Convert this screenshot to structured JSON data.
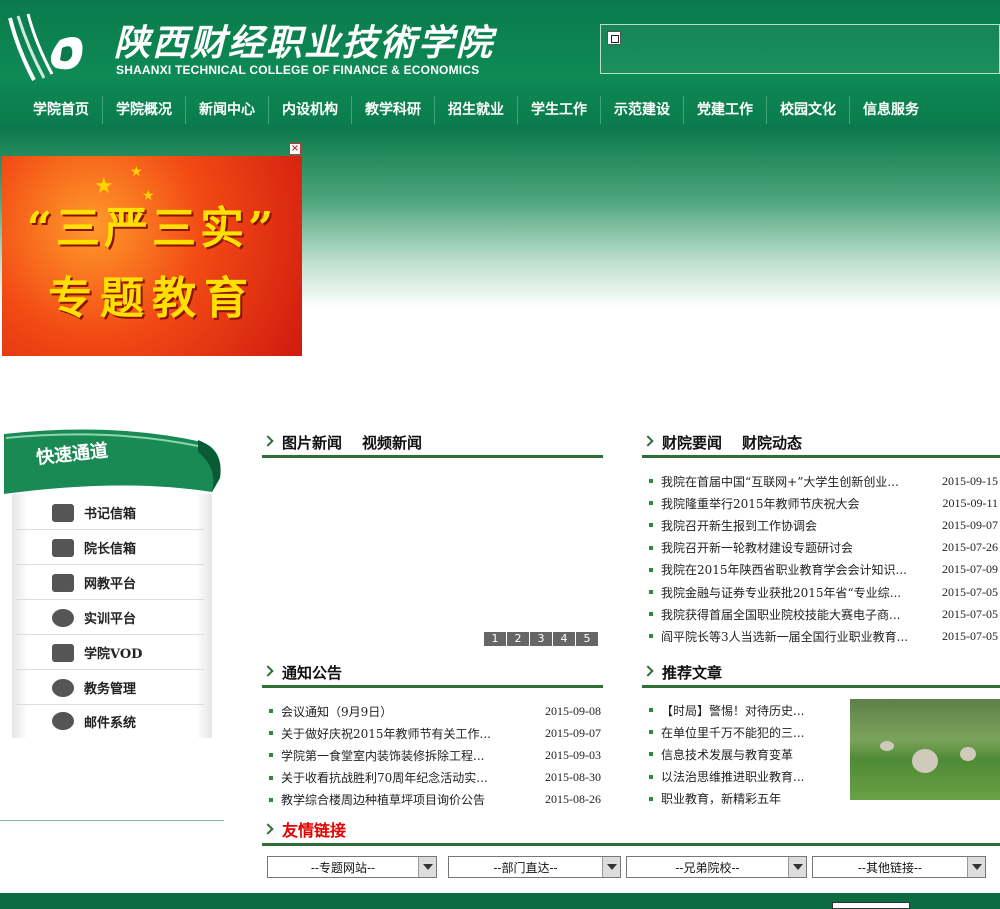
{
  "header": {
    "school_name_cn": "陕西财经职业技術学院",
    "school_name_en": "SHAANXI TECHNICAL COLLEGE OF FINANCE & ECONOMICS",
    "logo_icon": "college-logo-icon",
    "brand_color": "#0a7a4c"
  },
  "nav": {
    "items": [
      "学院首页",
      "学院概况",
      "新闻中心",
      "内设机构",
      "教学科研",
      "招生就业",
      "学生工作",
      "示范建设",
      "党建工作",
      "校园文化",
      "信息服务"
    ]
  },
  "banner": {
    "line1": "“三严三实”",
    "line2": "专题教育"
  },
  "quick": {
    "title": "快速通道",
    "items": [
      {
        "label": "书记信箱",
        "icon": "mailbox-icon"
      },
      {
        "label": "院长信箱",
        "icon": "envelope-icon"
      },
      {
        "label": "网教平台",
        "icon": "network-icon"
      },
      {
        "label": "实训平台",
        "icon": "refresh-icon"
      },
      {
        "label": "学院VOD",
        "icon": "monitor-icon"
      },
      {
        "label": "教务管理",
        "icon": "gear-icon"
      },
      {
        "label": "邮件系统",
        "icon": "mail-icon"
      }
    ]
  },
  "photo_news": {
    "tabs": [
      "图片新闻",
      "视频新闻"
    ],
    "pages": [
      "1",
      "2",
      "3",
      "4",
      "5"
    ]
  },
  "college_news": {
    "tabs": [
      "财院要闻",
      "财院动态"
    ],
    "items": [
      {
        "title": "我院在首届中国“互联网+”大学生创新创业...",
        "date": "2015-09-15"
      },
      {
        "title": "我院隆重举行2015年教师节庆祝大会",
        "date": "2015-09-11"
      },
      {
        "title": "我院召开新生报到工作协调会",
        "date": "2015-09-07"
      },
      {
        "title": "我院召开新一轮教材建设专题研讨会",
        "date": "2015-07-26"
      },
      {
        "title": "我院在2015年陕西省职业教育学会会计知识...",
        "date": "2015-07-09"
      },
      {
        "title": "我院金融与证券专业获批2015年省“专业综...",
        "date": "2015-07-05"
      },
      {
        "title": "我院获得首届全国职业院校技能大赛电子商...",
        "date": "2015-07-05"
      },
      {
        "title": "阎平院长等3人当选新一届全国行业职业教育...",
        "date": "2015-07-05"
      }
    ]
  },
  "notices": {
    "title": "通知公告",
    "items": [
      {
        "title": "会议通知（9月9日）",
        "date": "2015-09-08"
      },
      {
        "title": "关于做好庆祝2015年教师节有关工作...",
        "date": "2015-09-07"
      },
      {
        "title": "学院第一食堂室内装饰装修拆除工程...",
        "date": "2015-09-03"
      },
      {
        "title": "关于收看抗战胜利70周年纪念活动实...",
        "date": "2015-08-30"
      },
      {
        "title": "教学综合楼周边种植草坪项目询价公告",
        "date": "2015-08-26"
      }
    ]
  },
  "recommended": {
    "title": "推荐文章",
    "items": [
      "【时局】警惕！对待历史...",
      "在单位里千万不能犯的三...",
      "信息技术发展与教育变革",
      "以法治思维推进职业教育...",
      "职业教育，新精彩五年"
    ]
  },
  "links": {
    "title": "友情链接",
    "selects": [
      "--专题网站--",
      "--部门直达--",
      "--兄弟院校--",
      "--其他链接--"
    ]
  },
  "colors": {
    "accent_green": "#2e6f35",
    "link_title_red": "#e60000"
  }
}
